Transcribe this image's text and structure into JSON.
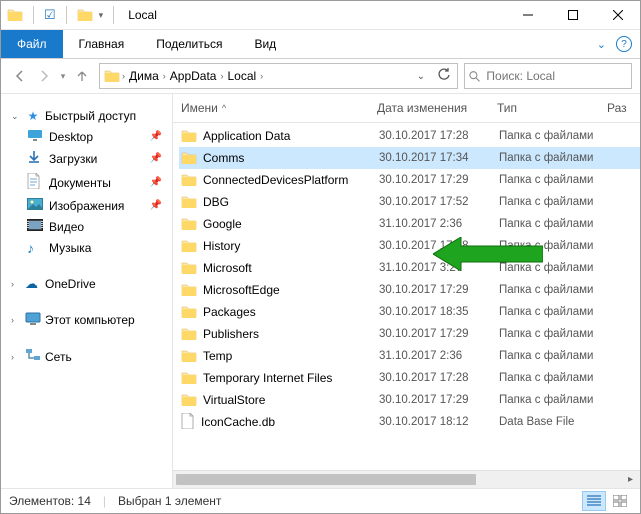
{
  "title": "Local",
  "ribbon": {
    "file": "Файл",
    "home": "Главная",
    "share": "Поделиться",
    "view": "Вид"
  },
  "breadcrumbs": [
    "Дима",
    "AppData",
    "Local"
  ],
  "search_placeholder": "Поиск: Local",
  "nav": {
    "quick_access": "Быстрый доступ",
    "items": [
      {
        "label": "Desktop"
      },
      {
        "label": "Загрузки"
      },
      {
        "label": "Документы"
      },
      {
        "label": "Изображения"
      },
      {
        "label": "Видео"
      },
      {
        "label": "Музыка"
      }
    ],
    "onedrive": "OneDrive",
    "this_pc": "Этот компьютер",
    "network": "Сеть"
  },
  "columns": {
    "name": "Имени",
    "date": "Дата изменения",
    "type": "Тип",
    "size": "Раз"
  },
  "rows": [
    {
      "name": "Application Data",
      "date": "30.10.2017 17:28",
      "type": "Папка с файлами",
      "kind": "folder"
    },
    {
      "name": "Comms",
      "date": "30.10.2017 17:34",
      "type": "Папка с файлами",
      "kind": "folder",
      "selected": true
    },
    {
      "name": "ConnectedDevicesPlatform",
      "date": "30.10.2017 17:29",
      "type": "Папка с файлами",
      "kind": "folder"
    },
    {
      "name": "DBG",
      "date": "30.10.2017 17:52",
      "type": "Папка с файлами",
      "kind": "folder"
    },
    {
      "name": "Google",
      "date": "31.10.2017 2:36",
      "type": "Папка с файлами",
      "kind": "folder"
    },
    {
      "name": "History",
      "date": "30.10.2017 17:28",
      "type": "Папка с файлами",
      "kind": "folder"
    },
    {
      "name": "Microsoft",
      "date": "31.10.2017 3:27",
      "type": "Папка с файлами",
      "kind": "folder"
    },
    {
      "name": "MicrosoftEdge",
      "date": "30.10.2017 17:29",
      "type": "Папка с файлами",
      "kind": "folder"
    },
    {
      "name": "Packages",
      "date": "30.10.2017 18:35",
      "type": "Папка с файлами",
      "kind": "folder"
    },
    {
      "name": "Publishers",
      "date": "30.10.2017 17:29",
      "type": "Папка с файлами",
      "kind": "folder"
    },
    {
      "name": "Temp",
      "date": "31.10.2017 2:36",
      "type": "Папка с файлами",
      "kind": "folder"
    },
    {
      "name": "Temporary Internet Files",
      "date": "30.10.2017 17:28",
      "type": "Папка с файлами",
      "kind": "folder"
    },
    {
      "name": "VirtualStore",
      "date": "30.10.2017 17:29",
      "type": "Папка с файлами",
      "kind": "folder"
    },
    {
      "name": "IconCache.db",
      "date": "30.10.2017 18:12",
      "type": "Data Base File",
      "kind": "file"
    }
  ],
  "status": {
    "count_label": "Элементов: 14",
    "selection_label": "Выбран 1 элемент"
  }
}
